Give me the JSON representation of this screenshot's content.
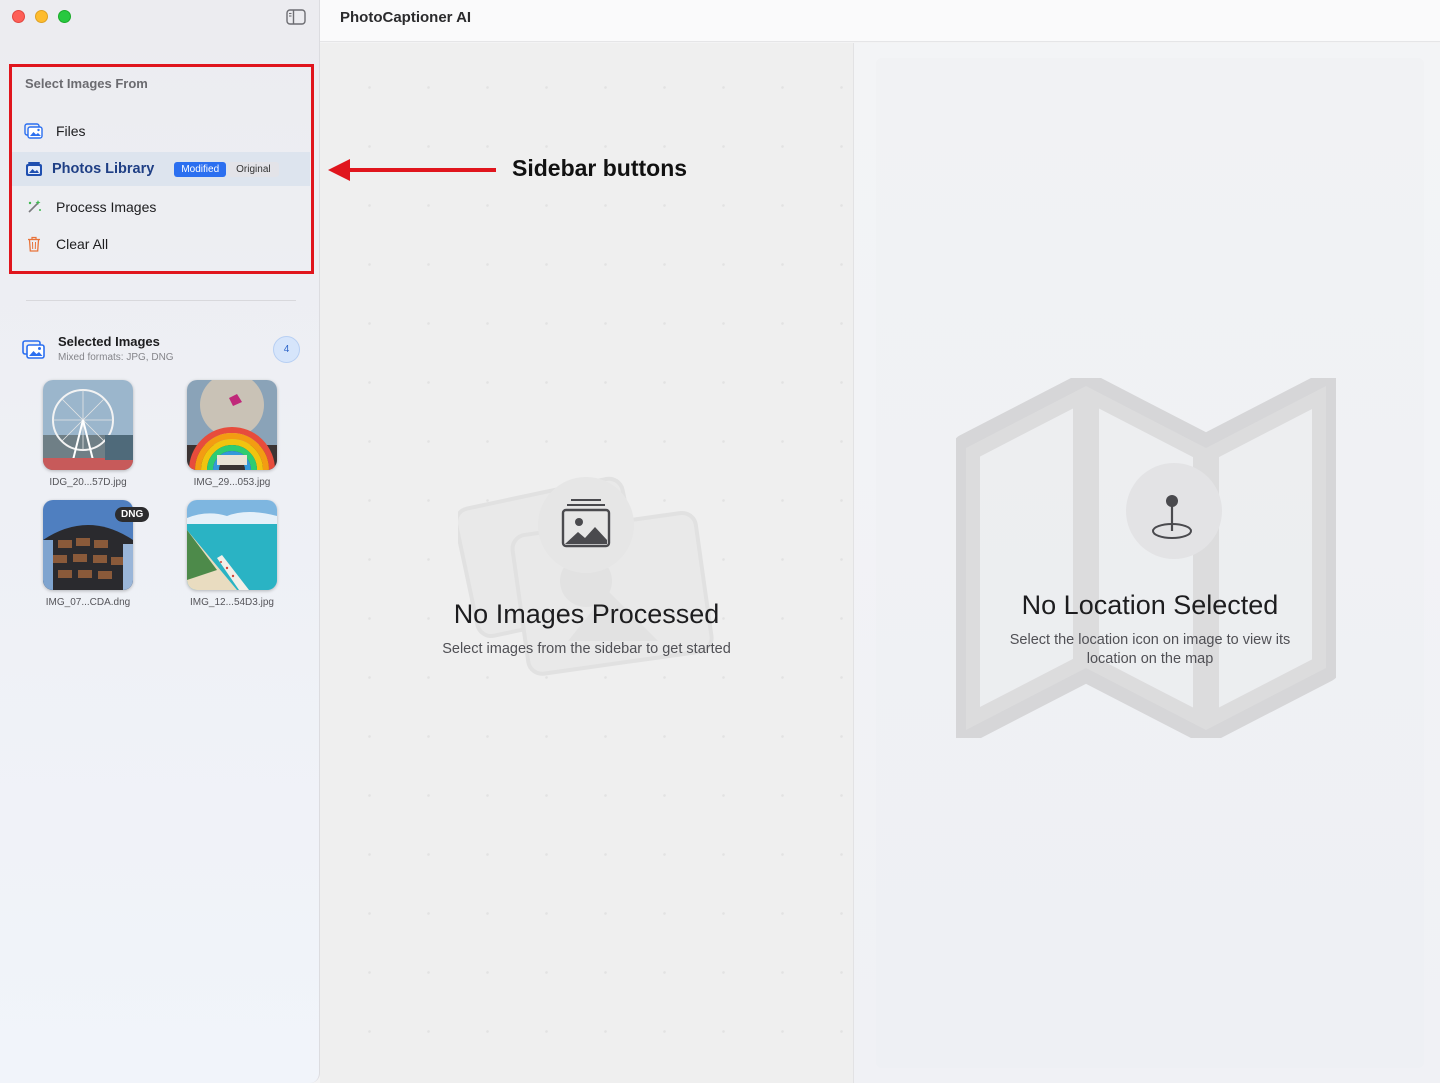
{
  "app": {
    "title": "PhotoCaptioner AI"
  },
  "sidebar": {
    "section_heading": "Select Images From",
    "items": [
      {
        "label": "Files",
        "icon": "photo-stack-icon"
      },
      {
        "label": "Photos Library",
        "icon": "photos-library-icon",
        "selected": true,
        "badges": {
          "modified": "Modified",
          "original": "Original"
        }
      },
      {
        "label": "Process Images",
        "icon": "magic-wand-icon"
      },
      {
        "label": "Clear All",
        "icon": "trash-icon"
      }
    ],
    "selected_images": {
      "title": "Selected Images",
      "subtitle": "Mixed formats: JPG, DNG",
      "count": "4",
      "images": [
        {
          "name": "IDG_20...57D.jpg",
          "subject": "ferris-wheel"
        },
        {
          "name": "IMG_29...053.jpg",
          "subject": "rainbow-arch"
        },
        {
          "name": "IMG_07...CDA.dng",
          "subject": "building",
          "badge": "DNG"
        },
        {
          "name": "IMG_12...54D3.jpg",
          "subject": "beach"
        }
      ]
    }
  },
  "center": {
    "title": "No Images Processed",
    "subtitle": "Select images from the sidebar to get started"
  },
  "map": {
    "title": "No Location Selected",
    "subtitle": "Select the location icon on image to view its location on the map"
  },
  "annotation": {
    "label": "Sidebar buttons",
    "color": "#e0151d"
  },
  "colors": {
    "accent": "#2b6ff0",
    "selected_row": "#dde4ee",
    "selected_text": "#1f3f85"
  }
}
